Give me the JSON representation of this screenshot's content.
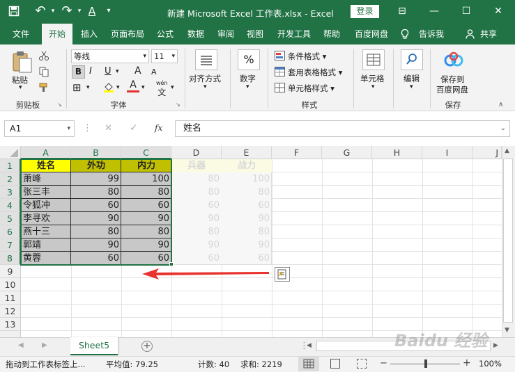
{
  "titlebar": {
    "title": "新建 Microsoft Excel 工作表.xlsx  -  Excel",
    "login": "登录",
    "save_glyph": "▪",
    "undo_glyph": "↶",
    "redo_glyph": "↷",
    "font_color_glyph": "A",
    "minimize": "—",
    "restore": "☐",
    "close": "✕",
    "ribbon_display": "⊟"
  },
  "tabs": [
    "文件",
    "开始",
    "插入",
    "页面布局",
    "公式",
    "数据",
    "审阅",
    "视图",
    "开发工具",
    "帮助",
    "百度网盘",
    "告诉我",
    "共享"
  ],
  "ribbon": {
    "clipboard": {
      "paste": "粘贴",
      "label": "剪贴板"
    },
    "font": {
      "name": "等线",
      "size": "11",
      "bold": "B",
      "italic": "I",
      "underline": "U",
      "grow": "A",
      "shrink": "A",
      "border_glyph": "⊞",
      "fill_glyph": "◢",
      "color_glyph": "A",
      "wen": "wén",
      "wen_char": "文",
      "label": "字体"
    },
    "align": {
      "label": "对齐方式"
    },
    "number": {
      "label": "数字",
      "symbol": "%"
    },
    "styles": {
      "cond_format": "条件格式",
      "table_format": "套用表格格式",
      "cell_styles": "单元格样式",
      "label": "样式"
    },
    "cells": {
      "label": "单元格"
    },
    "edit": {
      "label": "编辑"
    },
    "save": {
      "line1": "保存到",
      "line2": "百度网盘",
      "label": "保存"
    }
  },
  "formula_bar": {
    "name_box": "A1",
    "content": "姓名",
    "cancel": "✕",
    "enter": "✓",
    "fx": "fx"
  },
  "columns": [
    "A",
    "B",
    "C",
    "D",
    "E",
    "F",
    "G",
    "H",
    "I",
    "J"
  ],
  "rows": [
    "1",
    "2",
    "3",
    "4",
    "5",
    "6",
    "7",
    "8",
    "9",
    "10",
    "11",
    "12",
    "13"
  ],
  "sheet": {
    "headers": [
      "姓名",
      "外功",
      "内力",
      "兵器",
      "战力"
    ],
    "data": [
      [
        "萧峰",
        "99",
        "100",
        "80",
        "100"
      ],
      [
        "张三丰",
        "80",
        "80",
        "80",
        "80"
      ],
      [
        "令狐冲",
        "60",
        "60",
        "60",
        "60"
      ],
      [
        "李寻欢",
        "90",
        "90",
        "90",
        "90"
      ],
      [
        "燕十三",
        "80",
        "80",
        "80",
        "80"
      ],
      [
        "郭靖",
        "90",
        "90",
        "90",
        "90"
      ],
      [
        "黄蓉",
        "60",
        "60",
        "60",
        "60"
      ]
    ]
  },
  "sheet_tabs": {
    "active": "Sheet5",
    "add": "+"
  },
  "status": {
    "message": "拖动到工作表标签上...",
    "average": "平均值: 79.25",
    "count": "计数: 40",
    "sum": "求和: 2219",
    "zoom": "100%",
    "zoom_minus": "−",
    "zoom_plus": "+"
  },
  "watermark": "Baidu 经验",
  "colors": {
    "accent": "#217346",
    "header_yellow": "#ffff00",
    "header_olive": "#c0c000",
    "data_gray": "#c8c8c8",
    "arrow_red": "#e8332f"
  }
}
